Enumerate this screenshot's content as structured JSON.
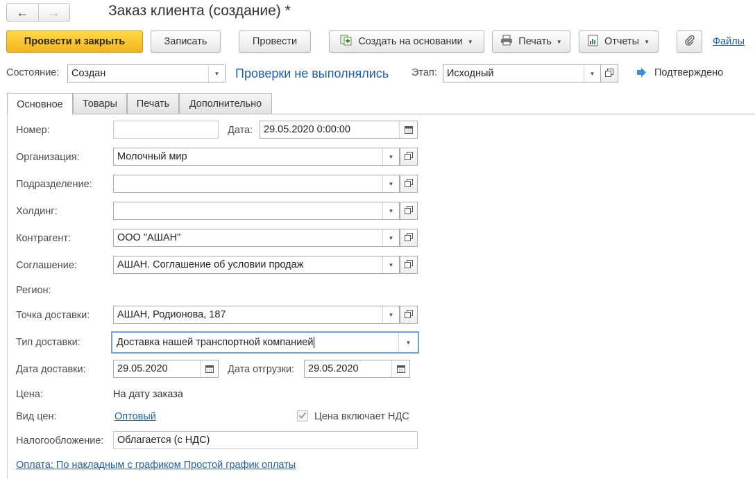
{
  "window": {
    "title": "Заказ клиента (создание) *"
  },
  "nav": {
    "back_icon": "arrow-left",
    "forward_icon": "arrow-right"
  },
  "toolbar": {
    "post_close": "Провести и закрыть",
    "save": "Записать",
    "post": "Провести",
    "create_based": "Создать на основании",
    "print": "Печать",
    "reports": "Отчеты",
    "files": "Файлы"
  },
  "status": {
    "state_label": "Состояние:",
    "state_value": "Создан",
    "checks_text": "Проверки не выполнялись",
    "stage_label": "Этап:",
    "stage_value": "Исходный",
    "confirmed_text": "Подтверждено"
  },
  "tabs": [
    {
      "label": "Основное",
      "active": true
    },
    {
      "label": "Товары",
      "active": false
    },
    {
      "label": "Печать",
      "active": false
    },
    {
      "label": "Дополнительно",
      "active": false
    }
  ],
  "form": {
    "number_label": "Номер:",
    "number_value": "",
    "date_label": "Дата:",
    "date_value": "29.05.2020  0:00:00",
    "org_label": "Организация:",
    "org_value": "Молочный мир",
    "dept_label": "Подразделение:",
    "dept_value": "",
    "holding_label": "Холдинг:",
    "holding_value": "",
    "partner_label": "Контрагент:",
    "partner_value": "ООО \"АШАН\"",
    "agreement_label": "Соглашение:",
    "agreement_value": "АШАН. Соглашение об условии продаж",
    "region_label": "Регион:",
    "delivery_point_label": "Точка доставки:",
    "delivery_point_value": "АШАН, Родионова, 187",
    "delivery_type_label": "Тип доставки:",
    "delivery_type_value": "Доставка нашей транспортной компанией",
    "delivery_date_label": "Дата доставки:",
    "delivery_date_value": "29.05.2020",
    "shipment_date_label": "Дата отгрузки:",
    "shipment_date_value": "29.05.2020",
    "price_label": "Цена:",
    "price_value": "На дату заказа",
    "price_type_label": "Вид цен:",
    "price_type_value": "Оптовый",
    "vat_included_label": "Цена включает НДС",
    "vat_included_checked": true,
    "tax_label": "Налогообложение:",
    "tax_value": "Облагается (с НДС)",
    "payment_link": "Оплата: По накладным с графиком Простой график оплаты"
  },
  "colors": {
    "primary": "#f5bd23",
    "link": "#1f5fb1",
    "focus": "#6aa2dc"
  }
}
